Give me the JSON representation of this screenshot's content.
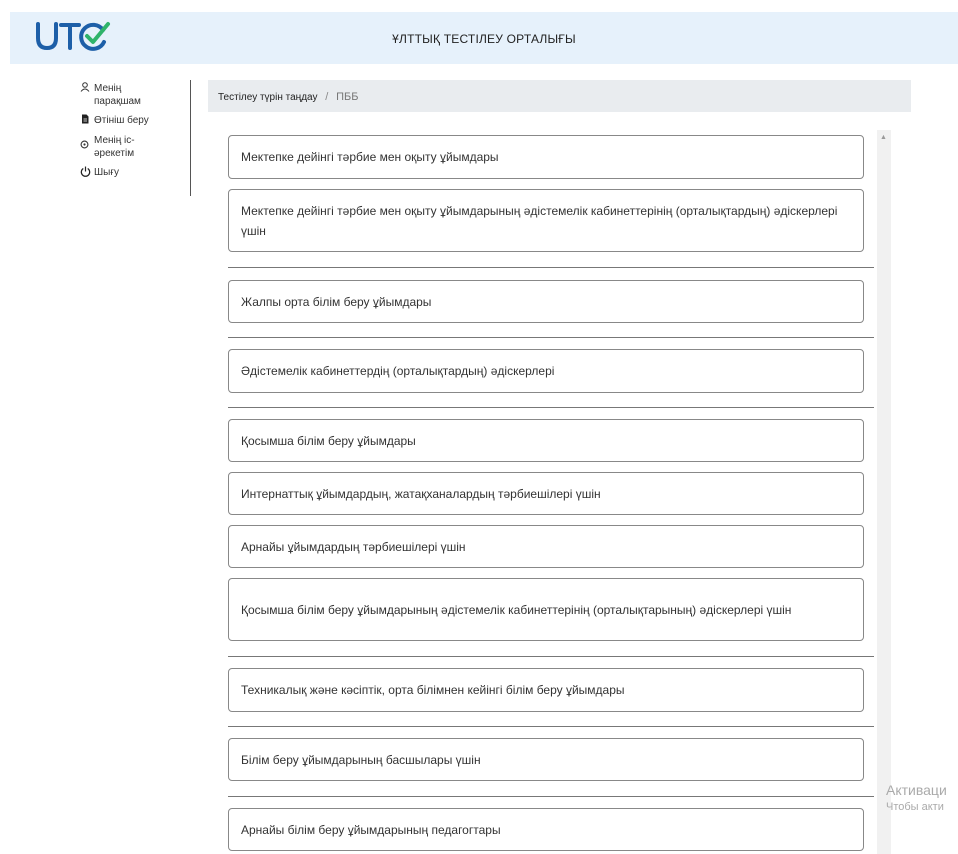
{
  "header": {
    "logo_text": "UTC",
    "title": "ҰЛТТЫҚ ТЕСТІЛЕУ ОРТАЛЫҒЫ"
  },
  "sidebar": {
    "items": [
      {
        "label": "Менің парақшам",
        "icon": "person-icon"
      },
      {
        "label": "Өтініш беру",
        "icon": "document-icon"
      },
      {
        "label": "Менің іс-әрекетім",
        "icon": "activity-icon"
      },
      {
        "label": "Шығу",
        "icon": "power-icon"
      }
    ]
  },
  "breadcrumb": {
    "parent": "Тестілеу түрін таңдау",
    "separator": "/",
    "current": "ПББ"
  },
  "options": [
    "Мектепке дейінгі тәрбие мен оқыту ұйымдары",
    "Мектепке дейінгі тәрбие мен оқыту ұйымдарының әдістемелік кабинеттерінің (орталықтардың) әдіскерлері үшін",
    "Жалпы орта білім беру ұйымдары",
    "Әдістемелік кабинеттердің (орталықтардың) әдіскерлері",
    "Қосымша білім беру ұйымдары",
    "Интернаттық ұйымдардың, жатақханалардың тәрбиешілері үшін",
    "Арнайы ұйымдардың тәрбиешілері үшін",
    "Қосымша білім беру ұйымдарының әдістемелік кабинеттерінің (орталықтарының) әдіскерлері үшін",
    "Техникалық және кәсіптік, орта білімнен кейінгі білім беру ұйымдары",
    "Білім беру ұйымдарының басшылары үшін",
    "Арнайы білім беру ұйымдарының педагогтары"
  ],
  "watermark": {
    "line1": "Активаци",
    "line2": "Чтобы акти"
  },
  "colors": {
    "header_bg": "#e6f1fb",
    "logo_blue": "#1d5fa8",
    "logo_green": "#2fb36a"
  }
}
